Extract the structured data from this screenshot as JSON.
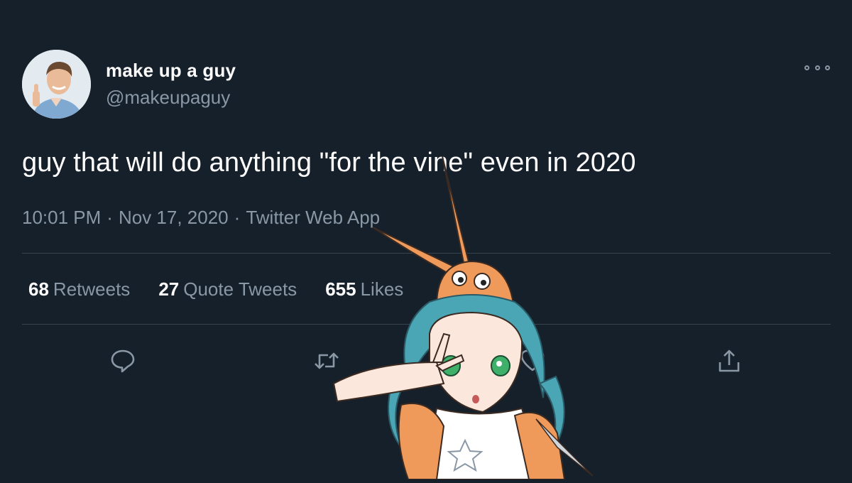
{
  "tweet": {
    "author": {
      "display_name": "make up a guy",
      "handle": "@makeupaguy",
      "avatar": "avatar-photo"
    },
    "text": "guy that will do anything \"for the vine\" even in 2020",
    "time": "10:01 PM",
    "separator": "·",
    "date": "Nov 17, 2020",
    "source": "Twitter Web App",
    "stats": {
      "retweets_count": "68",
      "retweets_label": "Retweets",
      "quotes_count": "27",
      "quotes_label": "Quote Tweets",
      "likes_count": "655",
      "likes_label": "Likes"
    },
    "actions": [
      "reply-icon",
      "retweet-icon",
      "like-icon",
      "share-icon"
    ],
    "more_icon": "more-options-icon"
  },
  "overlay": {
    "image": "anime-character-sticker"
  },
  "colors": {
    "background": "#16202b",
    "primary_text": "#ffffff",
    "secondary_text": "#8a98a6",
    "divider": "#38444d"
  }
}
